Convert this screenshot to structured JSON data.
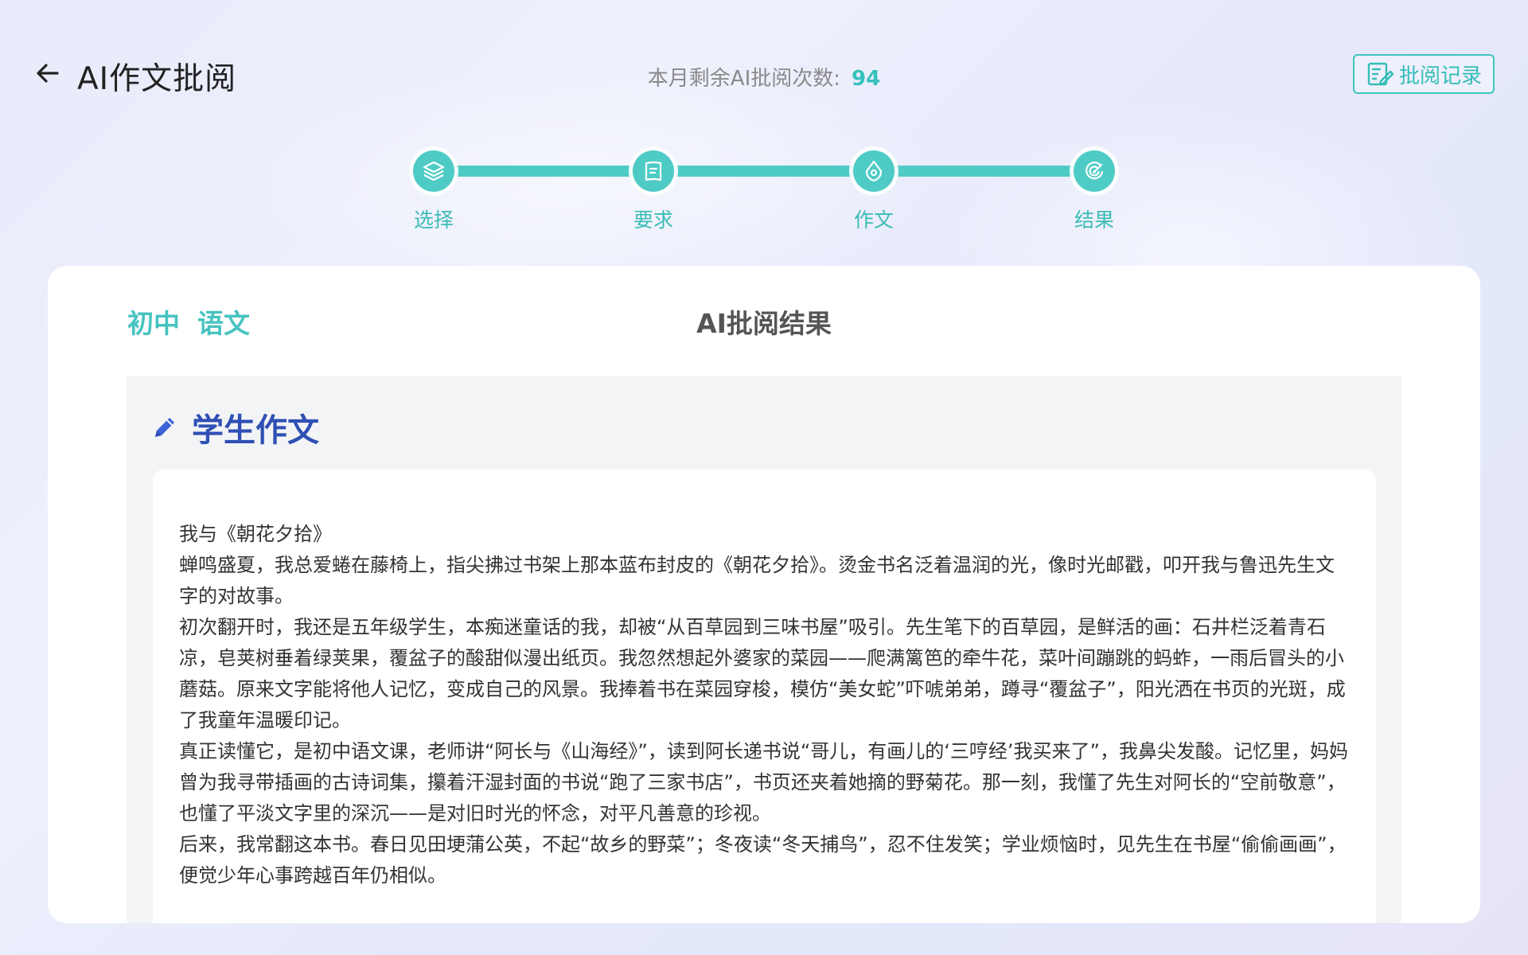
{
  "header": {
    "title": "AI作文批阅",
    "remaining_label": "本月剩余AI批阅次数:",
    "remaining_count": "94",
    "records_label": "批阅记录"
  },
  "steps": [
    {
      "label": "选择",
      "icon": "layers-icon"
    },
    {
      "label": "要求",
      "icon": "document-icon"
    },
    {
      "label": "作文",
      "icon": "pen-nib-icon"
    },
    {
      "label": "结果",
      "icon": "target-icon"
    }
  ],
  "card": {
    "grade": "初中",
    "subject": "语文",
    "title": "AI批阅结果",
    "section_title": "学生作文"
  },
  "essay": {
    "lines": [
      "我与《朝花夕拾》",
      "蝉鸣盛夏，我总爱蜷在藤椅上，指尖拂过书架上那本蓝布封皮的《朝花夕拾》。烫金书名泛着温润的光，像时光邮戳，叩开我与鲁迅先生文字的对故事。",
      "初次翻开时，我还是五年级学生，本痴迷童话的我，却被“从百草园到三味书屋”吸引。先生笔下的百草园，是鲜活的画：石井栏泛着青石凉，皂荚树垂着绿荚果，覆盆子的酸甜似漫出纸页。我忽然想起外婆家的菜园——爬满篱笆的牵牛花，菜叶间蹦跳的蚂蚱，一雨后冒头的小蘑菇。原来文字能将他人记忆，变成自己的风景。我捧着书在菜园穿梭，模仿“美女蛇”吓唬弟弟，蹲寻“覆盆子”，阳光洒在书页的光斑，成了我童年温暖印记。",
      "真正读懂它，是初中语文课，老师讲“阿长与《山海经》”，读到阿长递书说“哥儿，有画儿的‘三哼经’我买来了”，我鼻尖发酸。记忆里，妈妈曾为我寻带插画的古诗词集，攥着汗湿封面的书说“跑了三家书店”，书页还夹着她摘的野菊花。那一刻，我懂了先生对阿长的“空前敬意”，也懂了平淡文字里的深沉——是对旧时光的怀念，对平凡善意的珍视。",
      "后来，我常翻这本书。春日见田埂蒲公英，不起“故乡的野菜”；冬夜读“冬天捕鸟”，忍不住发笑；学业烦恼时，见先生在书屋“偷偷画画”，便觉少年心事跨越百年仍相似。"
    ]
  },
  "colors": {
    "accent": "#4fcbc6",
    "section_title": "#2f4fb4"
  }
}
